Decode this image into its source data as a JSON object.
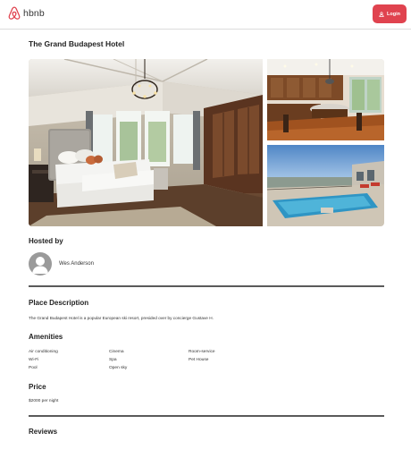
{
  "header": {
    "brand": "hbnb",
    "login_label": "Login"
  },
  "place": {
    "title": "The Grand Budapest Hotel",
    "photos": [
      "bedroom-photo",
      "kitchen-photo",
      "pool-photo"
    ]
  },
  "host": {
    "heading": "Hosted by",
    "name": "Wes Anderson"
  },
  "description": {
    "heading": "Place Description",
    "text": "The Grand Budapest Hotel is a popular European ski resort, presided over by concierge Gustave H."
  },
  "amenities": {
    "heading": "Amenities",
    "items": [
      "Air conditioning",
      "Wi-Fi",
      "Pool",
      "Cinema",
      "Spa",
      "Open sky",
      "Room-service",
      "Pet House"
    ]
  },
  "price": {
    "heading": "Price",
    "text": "$2000 per night"
  },
  "reviews": {
    "heading": "Reviews"
  },
  "colors": {
    "accent": "#e0434f",
    "divider": "#5a5a5a",
    "avatar": "#9a9a9a"
  }
}
